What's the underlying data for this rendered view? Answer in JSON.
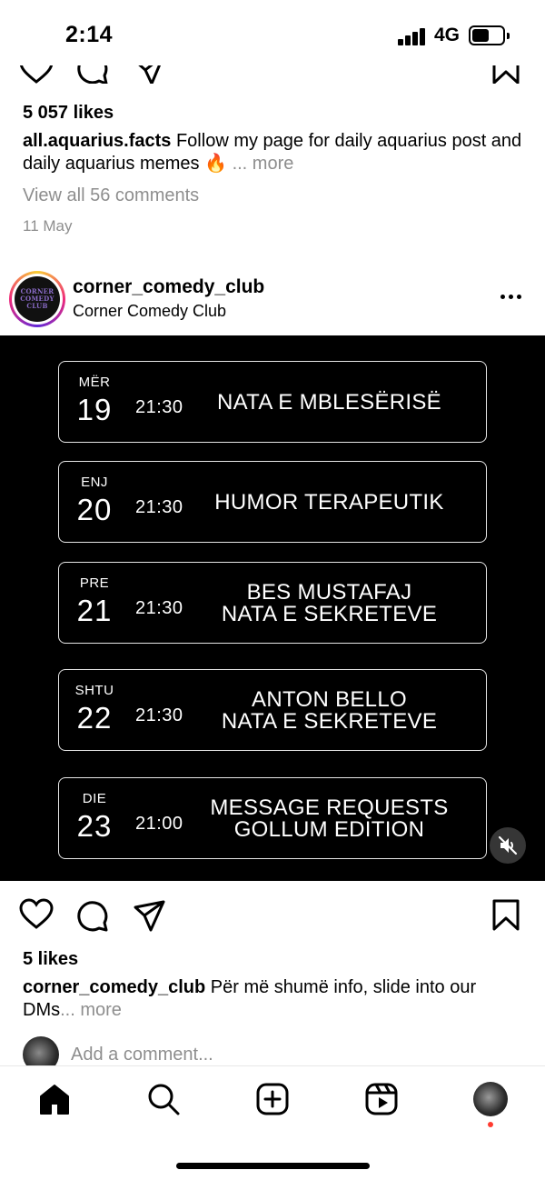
{
  "status_bar": {
    "time": "2:14",
    "network": "4G",
    "battery_level": 0.5
  },
  "previous_post": {
    "likes": "5 057 likes",
    "caption_user": "all.aquarius.facts",
    "caption_text": "Follow my page for daily aquarius post and daily aquarius memes",
    "caption_emoji": "🔥",
    "more_label": "... more",
    "view_comments": "View all 56 comments",
    "date": "11 May"
  },
  "post": {
    "avatar_text": [
      "CORNER",
      "COMEDY",
      "CLUB"
    ],
    "username": "corner_comedy_club",
    "display_name": "Corner Comedy Club",
    "events": [
      {
        "day": "MËR",
        "date": "19",
        "time": "21:30",
        "title_lines": [
          "NATA E MBLESËRISË"
        ]
      },
      {
        "day": "ENJ",
        "date": "20",
        "time": "21:30",
        "title_lines": [
          "HUMOR TERAPEUTIK"
        ]
      },
      {
        "day": "PRE",
        "date": "21",
        "time": "21:30",
        "title_lines": [
          "BES MUSTAFAJ",
          "NATA E SEKRETEVE"
        ]
      },
      {
        "day": "SHTU",
        "date": "22",
        "time": "21:30",
        "title_lines": [
          "ANTON BELLO",
          "NATA E SEKRETEVE"
        ]
      },
      {
        "day": "DIE",
        "date": "23",
        "time": "21:00",
        "title_lines": [
          "MESSAGE REQUESTS",
          "GOLLUM EDITION"
        ]
      }
    ],
    "likes": "5 likes",
    "caption_user": "corner_comedy_club",
    "caption_text": "Për më shumë info, slide into our DMs",
    "more_label": "... more",
    "comment_placeholder": "Add a comment..."
  },
  "icons": {
    "like": "heart-icon",
    "comment": "comment-icon",
    "share": "share-icon",
    "save": "bookmark-icon",
    "mute": "muted-speaker-icon",
    "nav": [
      "home-icon",
      "search-icon",
      "create-icon",
      "reels-icon",
      "profile-avatar"
    ]
  },
  "colors": {
    "muted_text": "#8e8e8e",
    "notification_dot": "#ff3b30",
    "media_background": "#000000"
  }
}
